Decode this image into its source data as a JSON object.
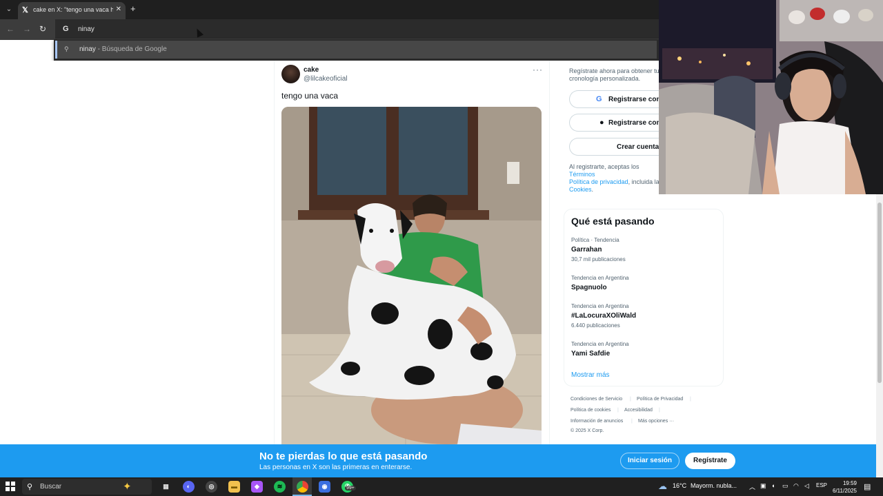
{
  "browser": {
    "tab_title": "cake en X: \"tengo una vaca http",
    "address_text": "ninay",
    "suggestion_query": "ninay",
    "suggestion_suffix": " - Búsqueda de Google"
  },
  "tweet": {
    "author_name": "cake",
    "author_handle": "@lilcakeoficial",
    "text": "tengo una vaca"
  },
  "signup": {
    "description": "Regístrate ahora para obtener tu cronología personalizada.",
    "google_label": "Registrarse con",
    "apple_label": "Registrarse con",
    "create_label": "Crear cuenta",
    "terms_prefix": "Al registrarte, aceptas los ",
    "terms_link": "Términos",
    "privacy_link": "Política de privacidad",
    "terms_mid": ", incluida la ",
    "cookies_link": "Cookies"
  },
  "trends": {
    "heading": "Qué está pasando",
    "items": [
      {
        "context": "Política · Tendencia",
        "title": "Garrahan",
        "count": "30,7 mil publicaciones"
      },
      {
        "context": "Tendencia en Argentina",
        "title": "Spagnuolo",
        "count": ""
      },
      {
        "context": "Tendencia en Argentina",
        "title": "#LaLocuraXOliWald",
        "count": "6.440 publicaciones"
      },
      {
        "context": "Tendencia en Argentina",
        "title": "Yami Safdie",
        "count": ""
      }
    ],
    "show_more": "Mostrar más"
  },
  "footer": {
    "terms": "Condiciones de Servicio",
    "privacy": "Política de Privacidad",
    "cookies": "Política de cookies",
    "accessibility": "Accesibilidad",
    "ads": "Información de anuncios",
    "more": "Más opciones ···",
    "copyright": "© 2025 X Corp."
  },
  "banner": {
    "headline": "No te pierdas lo que está pasando",
    "subline": "Las personas en X son las primeras en enterarse.",
    "login_label": "Iniciar sesión",
    "register_label": "Regístrate"
  },
  "taskbar": {
    "search_placeholder": "Buscar",
    "whatsapp_badge": "99+",
    "weather_temp": "16°C",
    "weather_desc": "Mayorm. nubla...",
    "language": "ESP",
    "time": "19:59",
    "date": "6/11/2025"
  }
}
